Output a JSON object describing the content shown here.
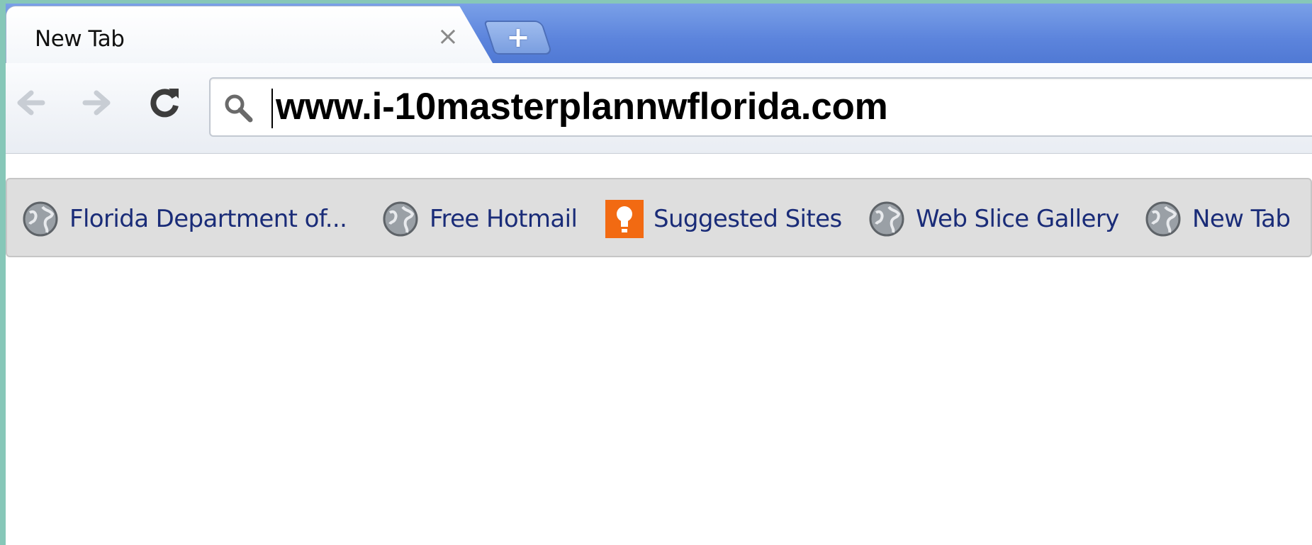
{
  "window": {
    "tab_title": "New Tab",
    "close_glyph": "×",
    "new_tab_glyph": "+"
  },
  "toolbar": {
    "back_icon": "back-arrow-icon",
    "forward_icon": "forward-arrow-icon",
    "reload_icon": "reload-icon",
    "omnibox_value": "www.i-10masterplannwflorida.com",
    "search_icon": "search-icon"
  },
  "bookmarks": {
    "items": [
      {
        "label": "Florida Department of...",
        "icon": "globe-icon"
      },
      {
        "label": "Free Hotmail",
        "icon": "globe-icon"
      },
      {
        "label": "Suggested Sites",
        "icon": "lightbulb-icon"
      },
      {
        "label": "Web Slice Gallery",
        "icon": "globe-icon"
      },
      {
        "label": "New Tab",
        "icon": "globe-icon"
      }
    ]
  },
  "colors": {
    "tabstrip": "#5c84dc",
    "bookmark_text": "#1a2c78",
    "suggested_icon_bg": "#f26a12",
    "frame_border": "#86c7b8"
  }
}
